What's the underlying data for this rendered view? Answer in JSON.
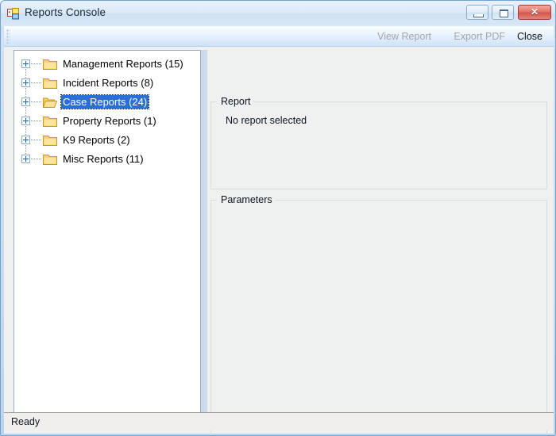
{
  "window": {
    "title": "Reports Console",
    "app_icon": "application-window-icon",
    "controls": {
      "minimize_label": "Minimize",
      "maximize_label": "Maximize",
      "close_glyph": "✕",
      "close_label": "Close"
    }
  },
  "toolbar": {
    "grip": "drag-grip",
    "items": [
      {
        "label": "View Report",
        "enabled": false
      },
      {
        "label": "Export PDF",
        "enabled": false
      },
      {
        "label": "Close",
        "enabled": true
      }
    ]
  },
  "tree": {
    "nodes": [
      {
        "label": "Management Reports (15)",
        "count": 15,
        "expanded": false,
        "selected": false
      },
      {
        "label": "Incident Reports (8)",
        "count": 8,
        "expanded": false,
        "selected": false
      },
      {
        "label": "Case Reports (24)",
        "count": 24,
        "expanded": false,
        "selected": true
      },
      {
        "label": "Property Reports (1)",
        "count": 1,
        "expanded": false,
        "selected": false
      },
      {
        "label": "K9 Reports (2)",
        "count": 2,
        "expanded": false,
        "selected": false
      },
      {
        "label": "Misc Reports (11)",
        "count": 11,
        "expanded": false,
        "selected": false
      }
    ]
  },
  "report_group": {
    "title": "Report",
    "empty_text": "No report selected"
  },
  "parameters_group": {
    "title": "Parameters"
  },
  "statusbar": {
    "text": "Ready"
  },
  "colors": {
    "selection_blue": "#2a6fd6",
    "frame_blue": "#bcd4ec",
    "close_red": "#d2564a",
    "folder_yellow": "#f5c544",
    "client_gray": "#eff0f0",
    "panel_white": "#ffffff"
  }
}
